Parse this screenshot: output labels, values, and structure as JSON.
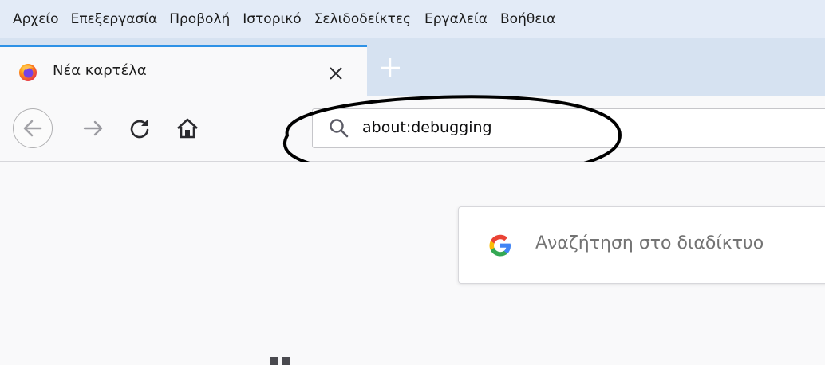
{
  "menubar": {
    "items": [
      {
        "label": "Αρχείο"
      },
      {
        "label": "Επεξεργασία"
      },
      {
        "label": "Προβολή"
      },
      {
        "label": "Ιστορικό"
      },
      {
        "label": "Σελιδοδείκτες"
      },
      {
        "label": "Εργαλεία"
      },
      {
        "label": "Βοήθεια"
      }
    ]
  },
  "tabs": [
    {
      "title": "Νέα καρτέλα",
      "icon": "firefox-icon",
      "active": true
    }
  ],
  "navbar": {
    "url_value": "about:debugging",
    "icons": [
      "back-icon",
      "forward-icon",
      "reload-icon",
      "home-icon",
      "search-icon"
    ]
  },
  "content": {
    "search_placeholder": "Αναζήτηση στο διαδίκτυο",
    "topsites_header": ""
  },
  "colors": {
    "menubar_bg": "#e3ebf7",
    "tabstrip_bg": "#d6e2f1",
    "active_tab_accent": "#2e92e6",
    "page_bg": "#f9f9fa"
  }
}
